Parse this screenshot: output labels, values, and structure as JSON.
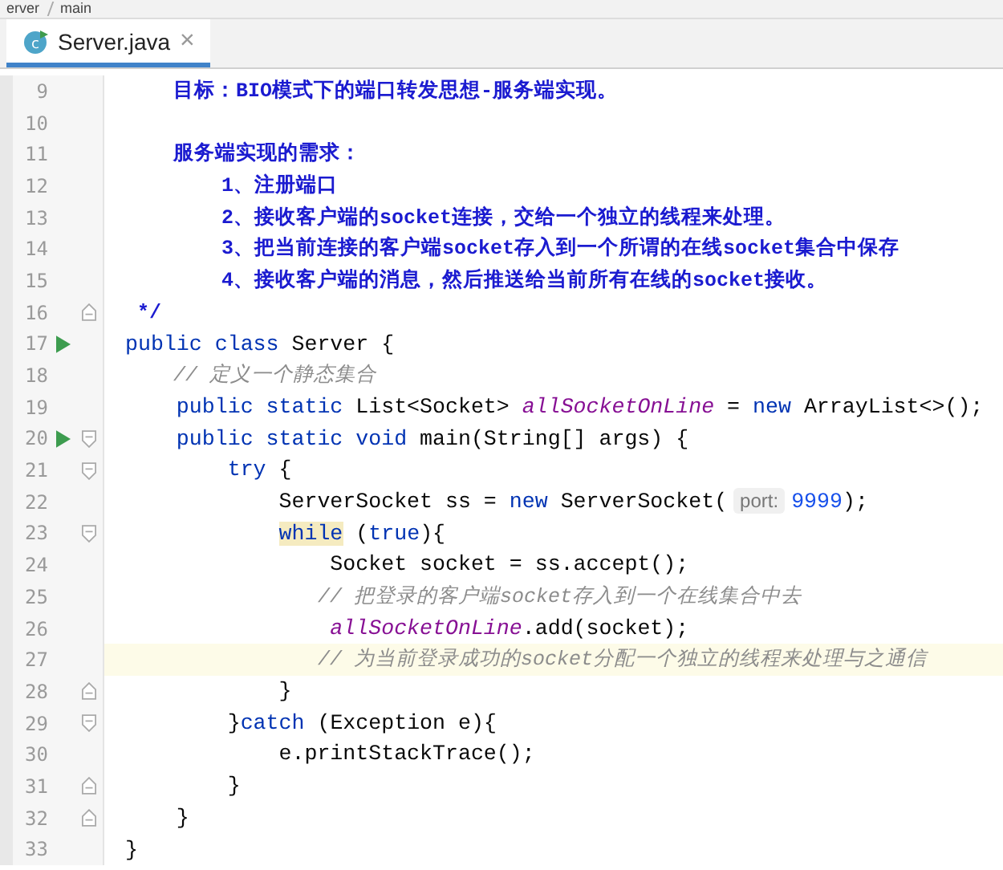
{
  "breadcrumb": [
    "erver",
    "main"
  ],
  "tabs": [
    {
      "label": "Server.java",
      "icon": "c",
      "selected": true,
      "close": "×"
    }
  ],
  "lines": [
    {
      "number": "9",
      "run": false,
      "fold_start": false,
      "fold_end": false,
      "current": false,
      "tokens": [
        {
          "kind": "doc",
          "text": "    目标：BIO模式下的端口转发思想-服务端实现。"
        }
      ]
    },
    {
      "number": "10",
      "run": false,
      "fold_start": false,
      "fold_end": false,
      "current": false
    },
    {
      "number": "11",
      "run": false,
      "fold_start": false,
      "fold_end": false,
      "current": false,
      "tokens": [
        {
          "kind": "doc",
          "text": "    服务端实现的需求："
        }
      ]
    },
    {
      "number": "12",
      "run": false,
      "fold_start": false,
      "fold_end": false,
      "current": false,
      "tokens": [
        {
          "kind": "doc",
          "text": "        1、注册端口"
        }
      ]
    },
    {
      "number": "13",
      "run": false,
      "fold_start": false,
      "fold_end": false,
      "current": false,
      "tokens": [
        {
          "kind": "doc",
          "text": "        2、接收客户端的socket连接，交给一个独立的线程来处理。"
        }
      ]
    },
    {
      "number": "14",
      "run": false,
      "fold_start": false,
      "fold_end": false,
      "current": false,
      "tokens": [
        {
          "kind": "doc",
          "text": "        3、把当前连接的客户端socket存入到一个所谓的在线socket集合中保存"
        }
      ]
    },
    {
      "number": "15",
      "run": false,
      "fold_start": false,
      "fold_end": false,
      "current": false,
      "tokens": [
        {
          "kind": "doc",
          "text": "        4、接收客户端的消息，然后推送给当前所有在线的socket接收。"
        }
      ]
    },
    {
      "number": "16",
      "run": false,
      "fold_start": false,
      "fold_end": true,
      "current": false,
      "tokens": [
        {
          "kind": "doc",
          "text": " */"
        }
      ]
    },
    {
      "number": "17",
      "run": true,
      "fold_start": false,
      "fold_end": false,
      "current": false,
      "tokens": [
        {
          "kind": "kw",
          "text": "public class "
        },
        {
          "kind": "text",
          "text": "Server {"
        }
      ]
    },
    {
      "number": "18",
      "run": false,
      "fold_start": false,
      "fold_end": false,
      "current": false,
      "tokens": [
        {
          "kind": "comment",
          "text": "    // 定义一个静态集合"
        }
      ]
    },
    {
      "number": "19",
      "run": false,
      "fold_start": false,
      "fold_end": false,
      "current": false,
      "tokens": [
        {
          "kind": "kw",
          "text": "    public static "
        },
        {
          "kind": "text",
          "text": "List<Socket> "
        },
        {
          "kind": "field",
          "text": "allSocketOnLine"
        },
        {
          "kind": "text",
          "text": " = "
        },
        {
          "kind": "kw",
          "text": "new "
        },
        {
          "kind": "text",
          "text": "ArrayList<>();"
        }
      ]
    },
    {
      "number": "20",
      "run": true,
      "fold_start": true,
      "fold_end": false,
      "current": false,
      "tokens": [
        {
          "kind": "kw",
          "text": "    public static void "
        },
        {
          "kind": "text",
          "text": "main(String[] args) {"
        }
      ]
    },
    {
      "number": "21",
      "run": false,
      "fold_start": true,
      "fold_end": false,
      "current": false,
      "tokens": [
        {
          "kind": "kw",
          "text": "        try "
        },
        {
          "kind": "text",
          "text": "{"
        }
      ]
    },
    {
      "number": "22",
      "run": false,
      "fold_start": false,
      "fold_end": false,
      "current": false,
      "tokens": [
        {
          "kind": "text",
          "text": "            ServerSocket ss = "
        },
        {
          "kind": "kw",
          "text": "new "
        },
        {
          "kind": "text",
          "text": "ServerSocket("
        },
        {
          "kind": "hint",
          "text": "port:"
        },
        {
          "kind": "number",
          "text": "9999"
        },
        {
          "kind": "text",
          "text": ");"
        }
      ]
    },
    {
      "number": "23",
      "run": false,
      "fold_start": true,
      "fold_end": false,
      "current": false,
      "tokens": [
        {
          "kind": "kw-match",
          "text": "            while"
        },
        {
          "kind": "text",
          "text": " ("
        },
        {
          "kind": "kw",
          "text": "true"
        },
        {
          "kind": "text",
          "text": "){"
        }
      ]
    },
    {
      "number": "24",
      "run": false,
      "fold_start": false,
      "fold_end": false,
      "current": false,
      "tokens": [
        {
          "kind": "text",
          "text": "                Socket socket = ss.accept();"
        }
      ]
    },
    {
      "number": "25",
      "run": false,
      "fold_start": false,
      "fold_end": false,
      "current": false,
      "tokens": [
        {
          "kind": "comment",
          "text": "                // 把登录的客户端socket存入到一个在线集合中去"
        }
      ]
    },
    {
      "number": "26",
      "run": false,
      "fold_start": false,
      "fold_end": false,
      "current": false,
      "tokens": [
        {
          "kind": "field",
          "text": "                allSocketOnLine"
        },
        {
          "kind": "text",
          "text": ".add(socket);"
        }
      ]
    },
    {
      "number": "27",
      "run": false,
      "fold_start": false,
      "fold_end": false,
      "current": true,
      "tokens": [
        {
          "kind": "comment",
          "text": "                // 为当前登录成功的socket分配一个独立的线程来处理与之通信"
        }
      ]
    },
    {
      "number": "28",
      "run": false,
      "fold_start": false,
      "fold_end": true,
      "current": false,
      "tokens": [
        {
          "kind": "text",
          "text": "            }"
        }
      ]
    },
    {
      "number": "29",
      "run": false,
      "fold_start": true,
      "fold_end": false,
      "current": false,
      "tokens": [
        {
          "kind": "text",
          "text": "        }"
        },
        {
          "kind": "kw",
          "text": "catch "
        },
        {
          "kind": "text",
          "text": "(Exception e){"
        }
      ]
    },
    {
      "number": "30",
      "run": false,
      "fold_start": false,
      "fold_end": false,
      "current": false,
      "tokens": [
        {
          "kind": "text",
          "text": "            e.printStackTrace();"
        }
      ]
    },
    {
      "number": "31",
      "run": false,
      "fold_start": false,
      "fold_end": true,
      "current": false,
      "tokens": [
        {
          "kind": "text",
          "text": "        }"
        }
      ]
    },
    {
      "number": "32",
      "run": false,
      "fold_start": false,
      "fold_end": true,
      "current": false,
      "tokens": [
        {
          "kind": "text",
          "text": "    }"
        }
      ]
    },
    {
      "number": "33",
      "run": false,
      "fold_start": false,
      "fold_end": false,
      "current": false,
      "tokens": [
        {
          "kind": "text",
          "text": "}"
        }
      ]
    }
  ]
}
